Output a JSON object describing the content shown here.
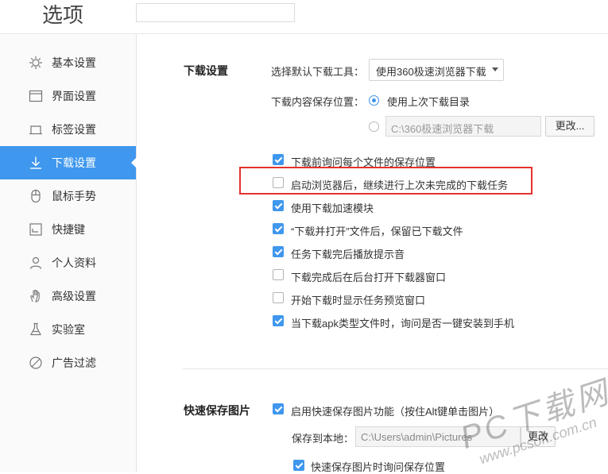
{
  "header": {
    "title": "选项",
    "search": {
      "value": "",
      "placeholder": ""
    }
  },
  "sidebar": {
    "items": [
      {
        "label": "基本设置",
        "icon": "gear-icon"
      },
      {
        "label": "界面设置",
        "icon": "window-icon"
      },
      {
        "label": "标签设置",
        "icon": "tab-icon"
      },
      {
        "label": "下载设置",
        "icon": "download-icon",
        "active": true
      },
      {
        "label": "鼠标手势",
        "icon": "mouse-icon"
      },
      {
        "label": "快捷键",
        "icon": "keyboard-icon"
      },
      {
        "label": "个人资料",
        "icon": "user-icon"
      },
      {
        "label": "高级设置",
        "icon": "hand-icon"
      },
      {
        "label": "实验室",
        "icon": "flask-icon"
      },
      {
        "label": "广告过滤",
        "icon": "block-icon"
      }
    ]
  },
  "download": {
    "section_title": "下载设置",
    "tool_label": "选择默认下载工具：",
    "tool_value": "使用360极速浏览器下载",
    "location_label": "下载内容保存位置：",
    "option_last_dir": "使用上次下载目录",
    "custom_path": "C:\\360极速浏览器下载",
    "change_button": "更改...",
    "options": [
      {
        "label": "下载前询问每个文件的保存位置",
        "checked": true
      },
      {
        "label": "启动浏览器后，继续进行上次未完成的下载任务",
        "checked": false
      },
      {
        "label": "使用下载加速模块",
        "checked": true
      },
      {
        "label": "“下载并打开”文件后，保留已下载文件",
        "checked": true
      },
      {
        "label": "任务下载完后播放提示音",
        "checked": true
      },
      {
        "label": "下载完成后在后台打开下载器窗口",
        "checked": false
      },
      {
        "label": "开始下载时显示任务预览窗口",
        "checked": false
      },
      {
        "label": "当下载apk类型文件时，询问是否一键安装到手机",
        "checked": true
      }
    ]
  },
  "quicksave": {
    "section_title": "快速保存图片",
    "enable_label": "启用快速保存图片功能（按住Alt键单击图片）",
    "save_to_label": "保存到本地：",
    "save_path": "C:\\Users\\admin\\Pictures",
    "change_button": "更改",
    "ask_label": "快速保存图片时询问保存位置"
  },
  "watermark": {
    "text": "PC下载网",
    "url": "www.pcsoft.com.cn"
  },
  "colors": {
    "accent": "#3f97ee",
    "highlight": "#e5322d"
  }
}
